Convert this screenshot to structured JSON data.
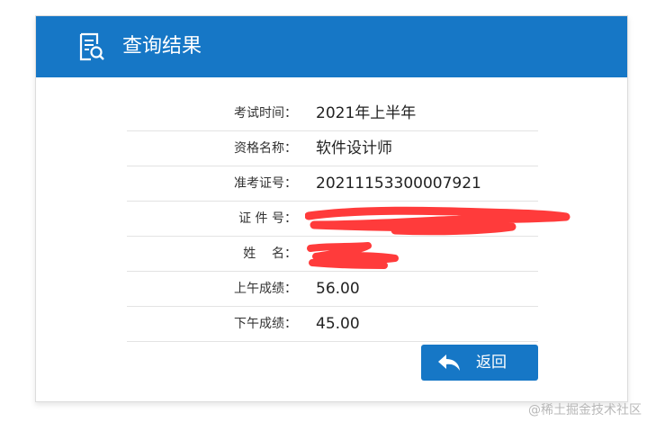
{
  "header": {
    "title": "查询结果",
    "icon": "document-search-icon",
    "background_color": "#1677c6"
  },
  "results": [
    {
      "label": "考试时间：",
      "value": "2021年上半年"
    },
    {
      "label": "资格名称：",
      "value": "软件设计师"
    },
    {
      "label": "准考证号：",
      "value": "20211153300007921"
    },
    {
      "label": "证 件 号：",
      "value": ""
    },
    {
      "label": "姓    名：",
      "value": ""
    },
    {
      "label": "上午成绩：",
      "value": "56.00"
    },
    {
      "label": "下午成绩：",
      "value": "45.00"
    }
  ],
  "back_button": {
    "label": "返回",
    "icon": "reply-arrow-icon"
  },
  "watermark": "@稀土掘金技术社区",
  "colors": {
    "accent": "#1677c6",
    "redaction": "#ff3b3b"
  }
}
